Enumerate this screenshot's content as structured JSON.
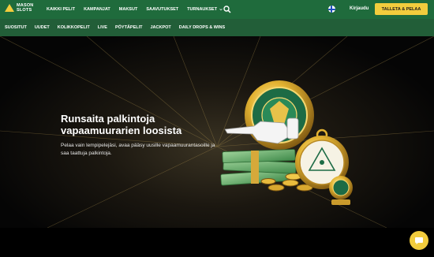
{
  "brand": {
    "line1": "MASON",
    "line2": "SLOTS"
  },
  "main_nav": [
    {
      "label": "KAIKKI PELIT"
    },
    {
      "label": "KAMPANJAT"
    },
    {
      "label": "MAKSUT"
    },
    {
      "label": "SAAVUTUKSET"
    },
    {
      "label": "TURNAUKSET"
    }
  ],
  "header": {
    "login_label": "Kirjaudu",
    "cta_label": "TALLETA & PELAA"
  },
  "sub_nav": [
    {
      "label": "SUOSITUT"
    },
    {
      "label": "UUDET"
    },
    {
      "label": "KOLIKKOPELIT"
    },
    {
      "label": "LIVE"
    },
    {
      "label": "PÖYTÄPELIT"
    },
    {
      "label": "JACKPOT"
    },
    {
      "label": "DAILY DROPS & WINS"
    }
  ],
  "hero": {
    "headline": "Runsaita palkintoja vapaamuurarien loosista",
    "description": "Pelaa vain lempipelejäsi, avaa pääsy uusille vapaamuurantasoille ja saa taattuja palkintoja."
  },
  "colors": {
    "nav_green": "#1f6b3c",
    "subnav_green": "#225e38",
    "accent_gold": "#f2cc3d"
  },
  "icons": [
    "search-icon",
    "finland-flag-icon",
    "chevron-down-icon",
    "chat-icon"
  ]
}
